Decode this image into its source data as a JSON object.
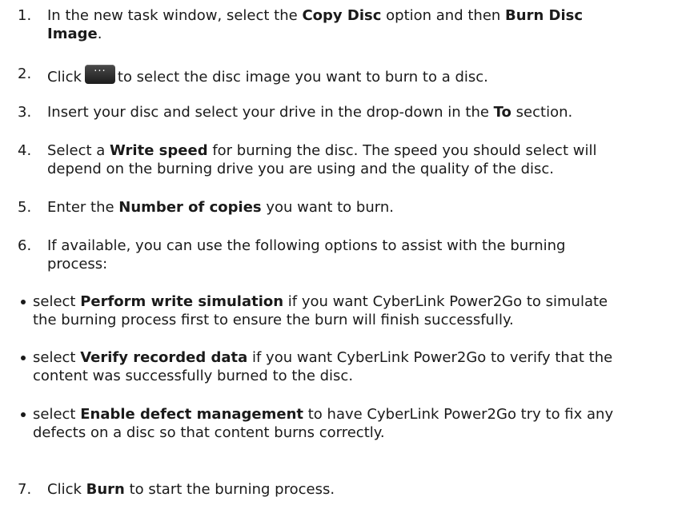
{
  "steps": [
    {
      "num": "1.",
      "pre": "In the new task window, select the ",
      "b1": "Copy Disc",
      "mid": " option and then ",
      "b2": "Burn Disc",
      "b3": "Image",
      "post": "."
    },
    {
      "num": "2.",
      "pre": "Click",
      "post": "to select the disc image you want to burn to a disc.",
      "button_glyph": "···"
    },
    {
      "num": "3.",
      "pre": "Insert your disc and select your drive in the drop-down in the ",
      "b1": "To",
      "post": " section."
    },
    {
      "num": "4.",
      "pre": "Select a ",
      "b1": "Write speed",
      "post": " for burning the disc. The speed you should select will",
      "line2": "depend on the burning drive you are using and the quality of the disc."
    },
    {
      "num": "5.",
      "pre": "Enter the ",
      "b1": "Number of copies",
      "post": " you want to burn."
    },
    {
      "num": "6.",
      "line1": "If available, you can use the following options to assist with the burning",
      "line2": "process:"
    },
    {
      "num": "7.",
      "pre": "Click ",
      "b1": "Burn",
      "post": " to start the burning process."
    }
  ],
  "bullets": [
    {
      "pre": "select ",
      "b1": "Perform write simulation",
      "post": " if you want CyberLink Power2Go to simulate",
      "line2": "the burning process first to ensure the burn will finish successfully."
    },
    {
      "pre": "select ",
      "b1": "Verify recorded data",
      "post": " if you want CyberLink Power2Go to verify that the",
      "line2": "content was successfully burned to the disc."
    },
    {
      "pre": "select ",
      "b1": "Enable defect management",
      "post": " to have CyberLink Power2Go try to fix any",
      "line2": "defects on a disc so that content burns correctly."
    }
  ]
}
